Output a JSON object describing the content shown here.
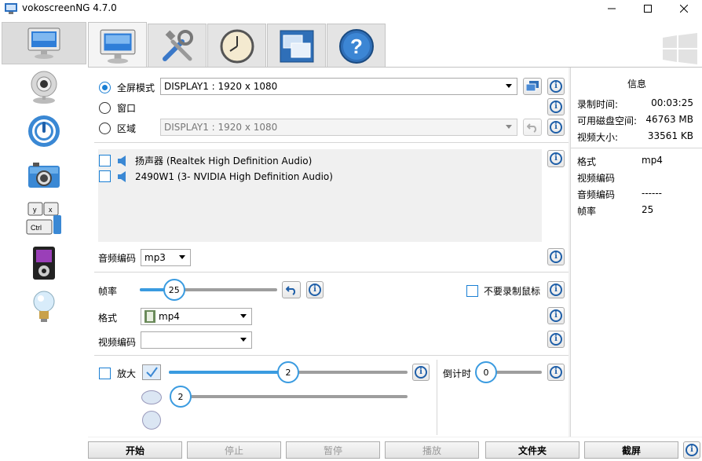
{
  "window": {
    "title": "vokoscreenNG 4.7.0",
    "minimize_glyph": "—",
    "maximize_glyph": "☐",
    "close_glyph": "✕"
  },
  "sidebar": {
    "items": [
      {
        "icon": "monitor-icon",
        "active": true
      },
      {
        "icon": "webcam-icon",
        "active": false
      },
      {
        "icon": "power-icon",
        "active": false
      },
      {
        "icon": "camera-icon",
        "active": false
      },
      {
        "icon": "keyboard-icon",
        "active": false
      },
      {
        "icon": "media-player-icon",
        "active": false
      },
      {
        "icon": "lightbulb-icon",
        "active": false
      }
    ]
  },
  "tabs": [
    {
      "icon": "monitor-icon",
      "active": true
    },
    {
      "icon": "tools-icon",
      "active": false
    },
    {
      "icon": "clock-icon",
      "active": false
    },
    {
      "icon": "windows-icon",
      "active": false
    },
    {
      "icon": "help-icon",
      "active": false
    }
  ],
  "screen": {
    "fullscreen_label": "全屏模式",
    "fullscreen_value": "DISPLAY1 : 1920 x 1080",
    "window_label": "窗口",
    "area_label": "区域",
    "area_value": "DISPLAY1 : 1920 x 1080"
  },
  "audio": {
    "devices": [
      "扬声器 (Realtek High Definition Audio)",
      "2490W1 (3- NVIDIA High Definition Audio)"
    ],
    "codec_label": "音频编码",
    "codec_value": "mp3"
  },
  "video": {
    "framerate_label": "帧率",
    "framerate_value": "25",
    "framerate_fraction": 0.25,
    "no_mouse_label": "不要录制鼠标",
    "format_label": "格式",
    "format_value": "mp4",
    "vcodec_label": "视频编码",
    "vcodec_value": ""
  },
  "magnifier": {
    "label": "放大",
    "value": "2",
    "value_fraction": 0.5,
    "second_value": "2",
    "countdown_label": "倒计时",
    "countdown_value": "0"
  },
  "info": {
    "title": "信息",
    "rows": [
      {
        "k": "录制时间:",
        "v": "00:03:25"
      },
      {
        "k": "可用磁盘空间:",
        "v": "46763 MB"
      },
      {
        "k": "视频大小:",
        "v": "33561 KB"
      }
    ],
    "details": [
      {
        "k": "格式",
        "v": "mp4"
      },
      {
        "k": "视频编码",
        "v": ""
      },
      {
        "k": "音频编码",
        "v": "------"
      },
      {
        "k": "帧率",
        "v": "25"
      }
    ]
  },
  "bottom": {
    "start": "开始",
    "stop": "停止",
    "pause": "暂停",
    "play": "播放",
    "folder": "文件夹",
    "screenshot": "截屏"
  },
  "colors": {
    "accent": "#3a9be0",
    "info_blue": "#1f5fa8"
  }
}
